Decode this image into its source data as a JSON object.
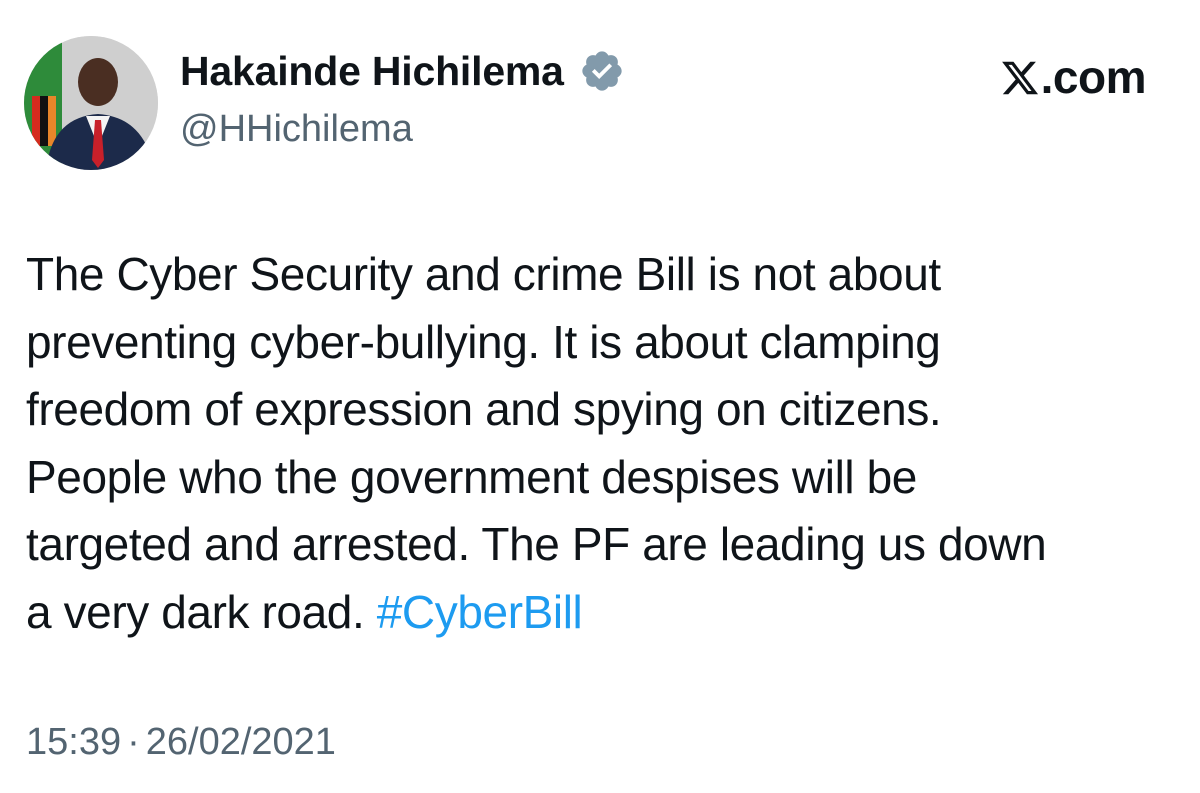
{
  "author": {
    "name": "Hakainde Hichilema",
    "handle": "@HHichilema",
    "verified": true,
    "verified_icon": "verified-badge-icon",
    "verified_color": "#829aab",
    "avatar": "profile-photo"
  },
  "site": {
    "label": ".com",
    "logo": "x-logo-icon"
  },
  "tweet": {
    "lines": [
      "The Cyber Security and crime Bill is not about",
      "preventing cyber-bullying. It is about clamping",
      "freedom of expression and spying on citizens.",
      "People who the government despises will be",
      "targeted and arrested. The PF are leading us down",
      "a very dark road."
    ],
    "hashtag": "#CyberBill",
    "hashtag_color": "#1d9bf0"
  },
  "meta": {
    "time": "15:39",
    "separator": "·",
    "date": "26/02/2021"
  }
}
